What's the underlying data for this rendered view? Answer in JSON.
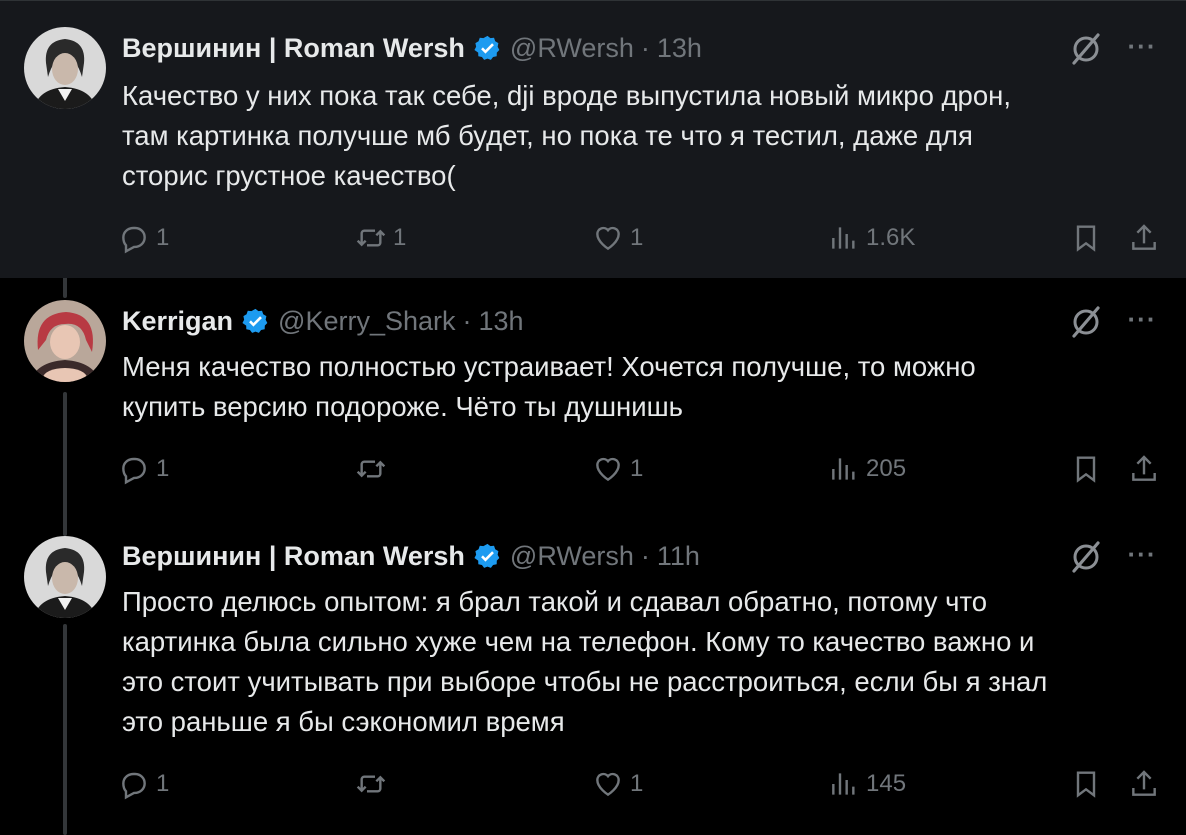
{
  "tweets": [
    {
      "author_name": "Вершинин | Roman Wersh",
      "handle": "@RWersh",
      "separator": "·",
      "time": "13h",
      "text": "Качество у них пока так себе, dji вроде выпустила новый микро дрон,\nтам картинка получше мб будет, но пока те что я тестил, даже для\nсторис грустное качество(",
      "replies": "1",
      "reposts": "1",
      "likes": "1",
      "views": "1.6K"
    },
    {
      "author_name": "Kerrigan",
      "handle": "@Kerry_Shark",
      "separator": "·",
      "time": "13h",
      "text": "Меня качество полностью устраивает! Хочется получше, то можно\nкупить версию подороже. Чёто ты душнишь",
      "replies": "1",
      "reposts": "",
      "likes": "1",
      "views": "205"
    },
    {
      "author_name": "Вершинин | Roman Wersh",
      "handle": "@RWersh",
      "separator": "·",
      "time": "11h",
      "text": "Просто делюсь опытом: я брал такой и сдавал обратно, потому что\nкартинка была сильно хуже чем на телефон. Кому то качество важно и\nэто стоит учитывать при выборе чтобы не расстроиться, если бы я знал\nэто раньше я бы сэкономил время",
      "replies": "1",
      "reposts": "",
      "likes": "1",
      "views": "145"
    }
  ],
  "icons": {
    "verified": "verified-badge-icon",
    "grok": "grok-icon",
    "more": "more-icon",
    "reply": "reply-icon",
    "repost": "repost-icon",
    "like": "heart-icon",
    "views": "views-icon",
    "bookmark": "bookmark-icon",
    "share": "share-icon"
  },
  "colors": {
    "background": "#000000",
    "highlighted_background": "#16181c",
    "text": "#e7e9ea",
    "muted": "#71767b",
    "verified_blue": "#1d9bf0"
  }
}
